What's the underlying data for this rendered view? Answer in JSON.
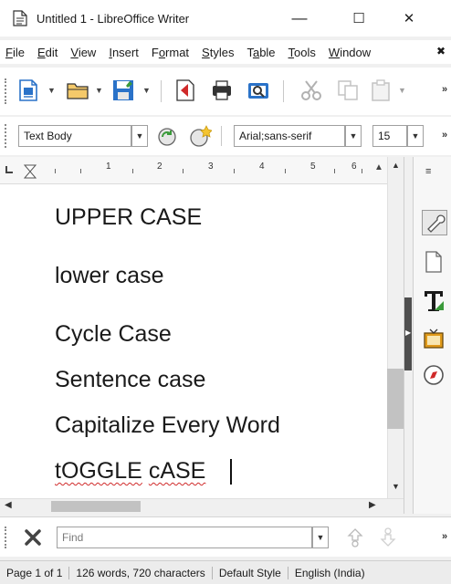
{
  "window": {
    "title": "Untitled 1 - LibreOffice Writer",
    "minimize_glyph": "—",
    "maximize_glyph": "☐",
    "close_glyph": "✕"
  },
  "menubar": {
    "items": [
      {
        "mnemonic": "F",
        "rest": "ile"
      },
      {
        "mnemonic": "E",
        "rest": "dit"
      },
      {
        "mnemonic": "V",
        "rest": "iew"
      },
      {
        "mnemonic": "I",
        "rest": "nsert"
      },
      {
        "prefix": "F",
        "mnemonic": "o",
        "rest": "rmat"
      },
      {
        "mnemonic": "S",
        "rest": "tyles"
      },
      {
        "prefix": "T",
        "mnemonic": "a",
        "rest": "ble"
      },
      {
        "mnemonic": "T",
        "rest": "ools"
      },
      {
        "mnemonic": "W",
        "rest": "indow"
      }
    ],
    "overflow_glyph": "✖"
  },
  "toolbar_formatting": {
    "paragraph_style": "Text Body",
    "font_name": "Arial;sans-serif",
    "font_size": "15",
    "overflow_glyph": "»"
  },
  "toolbar_standard": {
    "overflow_glyph": "»"
  },
  "ruler": {
    "numbers": [
      "1",
      "2",
      "3",
      "4",
      "5",
      "6"
    ]
  },
  "document": {
    "lines": [
      "UPPER CASE",
      "lower case",
      "Cycle Case",
      "Sentence case",
      "Capitalize Every Word"
    ],
    "toggle_word1": "tOGGLE",
    "toggle_word2": "cASE"
  },
  "findbar": {
    "placeholder": "Find",
    "overflow_glyph": "»"
  },
  "statusbar": {
    "page": "Page 1 of 1",
    "word_count": "126 words, 720 characters",
    "page_style": "Default Style",
    "language": "English (India)"
  },
  "colors": {
    "accent_green": "#3a9a3a",
    "accent_red": "#d02a2a",
    "accent_blue": "#2a72c8",
    "accent_orange": "#e09a1a"
  },
  "icons": [
    "document-app-icon",
    "new-document-icon",
    "open-folder-icon",
    "save-icon",
    "export-pdf-icon",
    "print-icon",
    "print-preview-icon",
    "cut-icon",
    "copy-icon",
    "paste-icon",
    "update-style-icon",
    "new-style-icon",
    "properties-wrench-icon",
    "page-icon",
    "styles-t-icon",
    "gallery-icon",
    "navigator-compass-icon",
    "close-find-icon",
    "find-previous-icon",
    "find-next-icon"
  ]
}
